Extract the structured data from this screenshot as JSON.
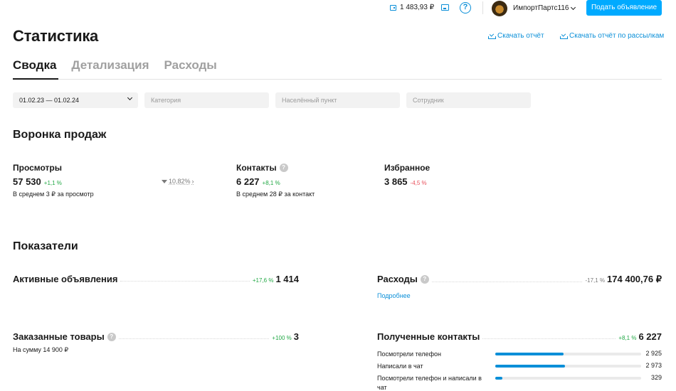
{
  "topbar": {
    "balance": "1 483,93 ₽",
    "user_name": "ИмпортПартс116",
    "post_button": "Подать объявление"
  },
  "header": {
    "title": "Статистика",
    "download_report": "Скачать отчёт",
    "download_mailing": "Скачать отчёт по рассылкам"
  },
  "tabs": [
    {
      "label": "Сводка",
      "active": true
    },
    {
      "label": "Детализация",
      "active": false
    },
    {
      "label": "Расходы",
      "active": false
    }
  ],
  "filters": {
    "date_range": "01.02.23 — 01.02.24",
    "category_placeholder": "Категория",
    "city_placeholder": "Населённый пункт",
    "employee_placeholder": "Сотрудник"
  },
  "funnel": {
    "title": "Воронка продаж",
    "views": {
      "label": "Просмотры",
      "value": "57 530",
      "delta": "+1,1 %",
      "note": "В среднем 3 ₽ за просмотр"
    },
    "conversion": "10,82%",
    "contacts": {
      "label": "Контакты",
      "value": "6 227",
      "delta": "+8,1 %",
      "note": "В среднем 28 ₽ за контакт"
    },
    "favorites": {
      "label": "Избранное",
      "value": "3 865",
      "delta": "-4,5 %"
    }
  },
  "metrics": {
    "title": "Показатели",
    "active_ads": {
      "label": "Активные объявления",
      "delta": "+17,6 %",
      "value": "1 414"
    },
    "expenses": {
      "label": "Расходы",
      "delta": "-17,1 %",
      "value": "174 400,76 ₽",
      "link": "Подробнее"
    },
    "ordered_goods": {
      "label": "Заказанные товары",
      "delta": "+100 %",
      "value": "3",
      "note": "На сумму 14 900 ₽"
    },
    "received_contacts": {
      "label": "Полученные контакты",
      "delta": "+8,1 %",
      "value": "6 227",
      "rows": [
        {
          "label": "Посмотрели телефон",
          "value": "2 925",
          "share": 0.47
        },
        {
          "label": "Написали в чат",
          "value": "2 973",
          "share": 0.48
        },
        {
          "label": "Посмотрели телефон и написали в чат",
          "value": "329",
          "share": 0.05
        }
      ]
    }
  },
  "colors": {
    "accent": "#00aaff",
    "link": "#0a8fd8",
    "positive": "#22a845",
    "negative": "#e8505b"
  }
}
